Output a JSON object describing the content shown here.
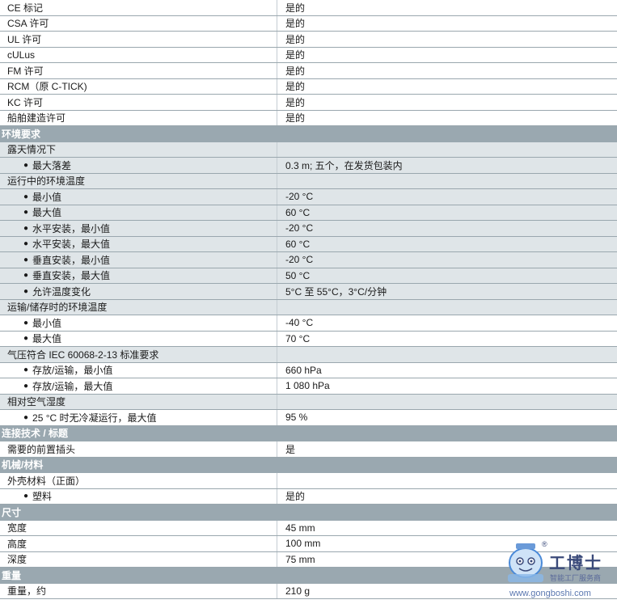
{
  "rows": [
    {
      "type": "white",
      "label": "CE 标记",
      "value": "是的"
    },
    {
      "type": "white",
      "label": "CSA 许可",
      "value": "是的"
    },
    {
      "type": "white",
      "label": "UL 许可",
      "value": "是的"
    },
    {
      "type": "white",
      "label": "cULus",
      "value": "是的"
    },
    {
      "type": "white",
      "label": "FM 许可",
      "value": "是的"
    },
    {
      "type": "white",
      "label": "RCM（原 C-TICK)",
      "value": "是的"
    },
    {
      "type": "white",
      "label": "KC 许可",
      "value": "是的"
    },
    {
      "type": "white",
      "label": "船舶建造许可",
      "value": "是的"
    },
    {
      "type": "header",
      "label": "环境要求",
      "value": ""
    },
    {
      "type": "grey",
      "label": "露天情况下",
      "value": ""
    },
    {
      "type": "grey",
      "bullet": true,
      "label": "最大落差",
      "value": "0.3 m; 五个，在发货包装内"
    },
    {
      "type": "grey",
      "label": "运行中的环境温度",
      "value": ""
    },
    {
      "type": "grey",
      "bullet": true,
      "label": "最小值",
      "value": "-20 °C"
    },
    {
      "type": "grey",
      "bullet": true,
      "label": "最大值",
      "value": "60 °C"
    },
    {
      "type": "grey",
      "bullet": true,
      "label": "水平安装，最小值",
      "value": "-20 °C"
    },
    {
      "type": "grey",
      "bullet": true,
      "label": "水平安装，最大值",
      "value": "60 °C"
    },
    {
      "type": "grey",
      "bullet": true,
      "label": "垂直安装，最小值",
      "value": "-20 °C"
    },
    {
      "type": "grey",
      "bullet": true,
      "label": "垂直安装，最大值",
      "value": "50 °C"
    },
    {
      "type": "grey",
      "bullet": true,
      "label": "允许温度变化",
      "value": "5°C 至 55°C，3°C/分钟"
    },
    {
      "type": "grey",
      "label": "运输/储存时的环境温度",
      "value": ""
    },
    {
      "type": "white",
      "bullet": true,
      "label": "最小值",
      "value": "-40 °C"
    },
    {
      "type": "white",
      "bullet": true,
      "label": "最大值",
      "value": "70 °C"
    },
    {
      "type": "grey",
      "label": "气压符合 IEC 60068-2-13 标准要求",
      "value": ""
    },
    {
      "type": "white",
      "bullet": true,
      "label": "存放/运输，最小值",
      "value": "660 hPa"
    },
    {
      "type": "white",
      "bullet": true,
      "label": "存放/运输，最大值",
      "value": "1 080 hPa"
    },
    {
      "type": "grey",
      "label": "相对空气湿度",
      "value": ""
    },
    {
      "type": "white",
      "bullet": true,
      "label": "25 °C 时无冷凝运行，最大值",
      "value": "95 %"
    },
    {
      "type": "header",
      "label": "连接技术 / 标题",
      "value": ""
    },
    {
      "type": "white",
      "label": "需要的前置插头",
      "value": "是"
    },
    {
      "type": "header",
      "label": "机械/材料",
      "value": ""
    },
    {
      "type": "white",
      "label": "外壳材料（正面）",
      "value": ""
    },
    {
      "type": "white",
      "bullet": true,
      "label": "塑料",
      "value": "是的"
    },
    {
      "type": "header",
      "label": "尺寸",
      "value": ""
    },
    {
      "type": "white",
      "label": "宽度",
      "value": "45 mm"
    },
    {
      "type": "white",
      "label": "高度",
      "value": "100 mm"
    },
    {
      "type": "white",
      "label": "深度",
      "value": "75 mm"
    },
    {
      "type": "header",
      "label": "重量",
      "value": ""
    },
    {
      "type": "white",
      "label": "重量，约",
      "value": "210 g"
    }
  ],
  "watermark": {
    "brand": "工博士",
    "tagline": "智能工厂服务商",
    "url": "www.gongboshi.com",
    "registered": "®",
    "colors": {
      "primary": "#3a4a7a",
      "accent": "#4a8ad8"
    }
  }
}
